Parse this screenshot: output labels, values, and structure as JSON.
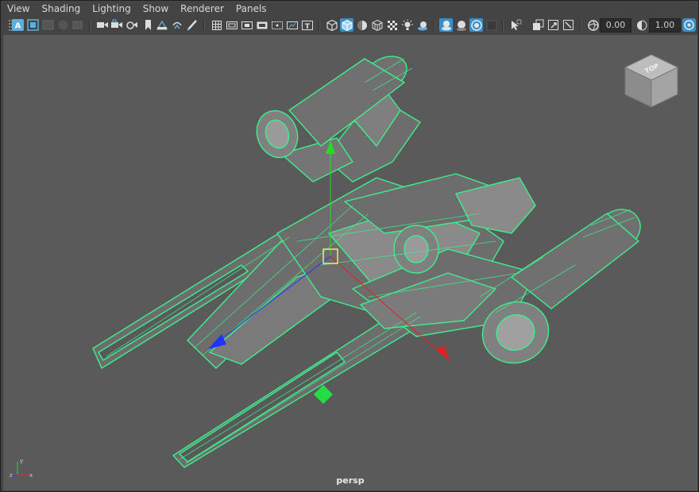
{
  "menu": [
    "View",
    "Shading",
    "Lighting",
    "Show",
    "Renderer",
    "Panels"
  ],
  "toolbar": {
    "exposure_value": "0.00",
    "gamma_value": "1.00",
    "colors": {
      "accent": "#5bb0e0",
      "active": "#3a8fc9"
    },
    "icons": [
      "select-camera-icon",
      "camera-attributes-icon",
      "bookmark-icon",
      "image-plane-icon",
      "2d-pan-zoom-icon",
      "grease-pencil-icon",
      "grid-icon",
      "film-gate-icon",
      "resolution-gate-icon",
      "gate-mask-icon",
      "field-chart-icon",
      "safe-action-icon",
      "safe-title-icon",
      "wireframe-icon",
      "smooth-shade-icon",
      "default-material-icon",
      "textured-icon",
      "use-all-lights-icon",
      "shadows-icon",
      "ambient-occlusion-icon",
      "screen-space-reflection-icon",
      "motion-blur-icon",
      "xray-icon",
      "xray-joints-icon",
      "isolate-select-icon",
      "wireframe-on-shaded-icon",
      "xray-active-icon",
      "exposure-icon",
      "gamma-icon",
      "color-management-icon"
    ]
  },
  "viewport": {
    "camera_label": "persp",
    "viewcube_face": "TOP",
    "background_color": "#5a5a5a",
    "wireframe_color": "#3cf08c",
    "axis_labels": {
      "x": "x",
      "y": "y",
      "z": "z"
    }
  }
}
